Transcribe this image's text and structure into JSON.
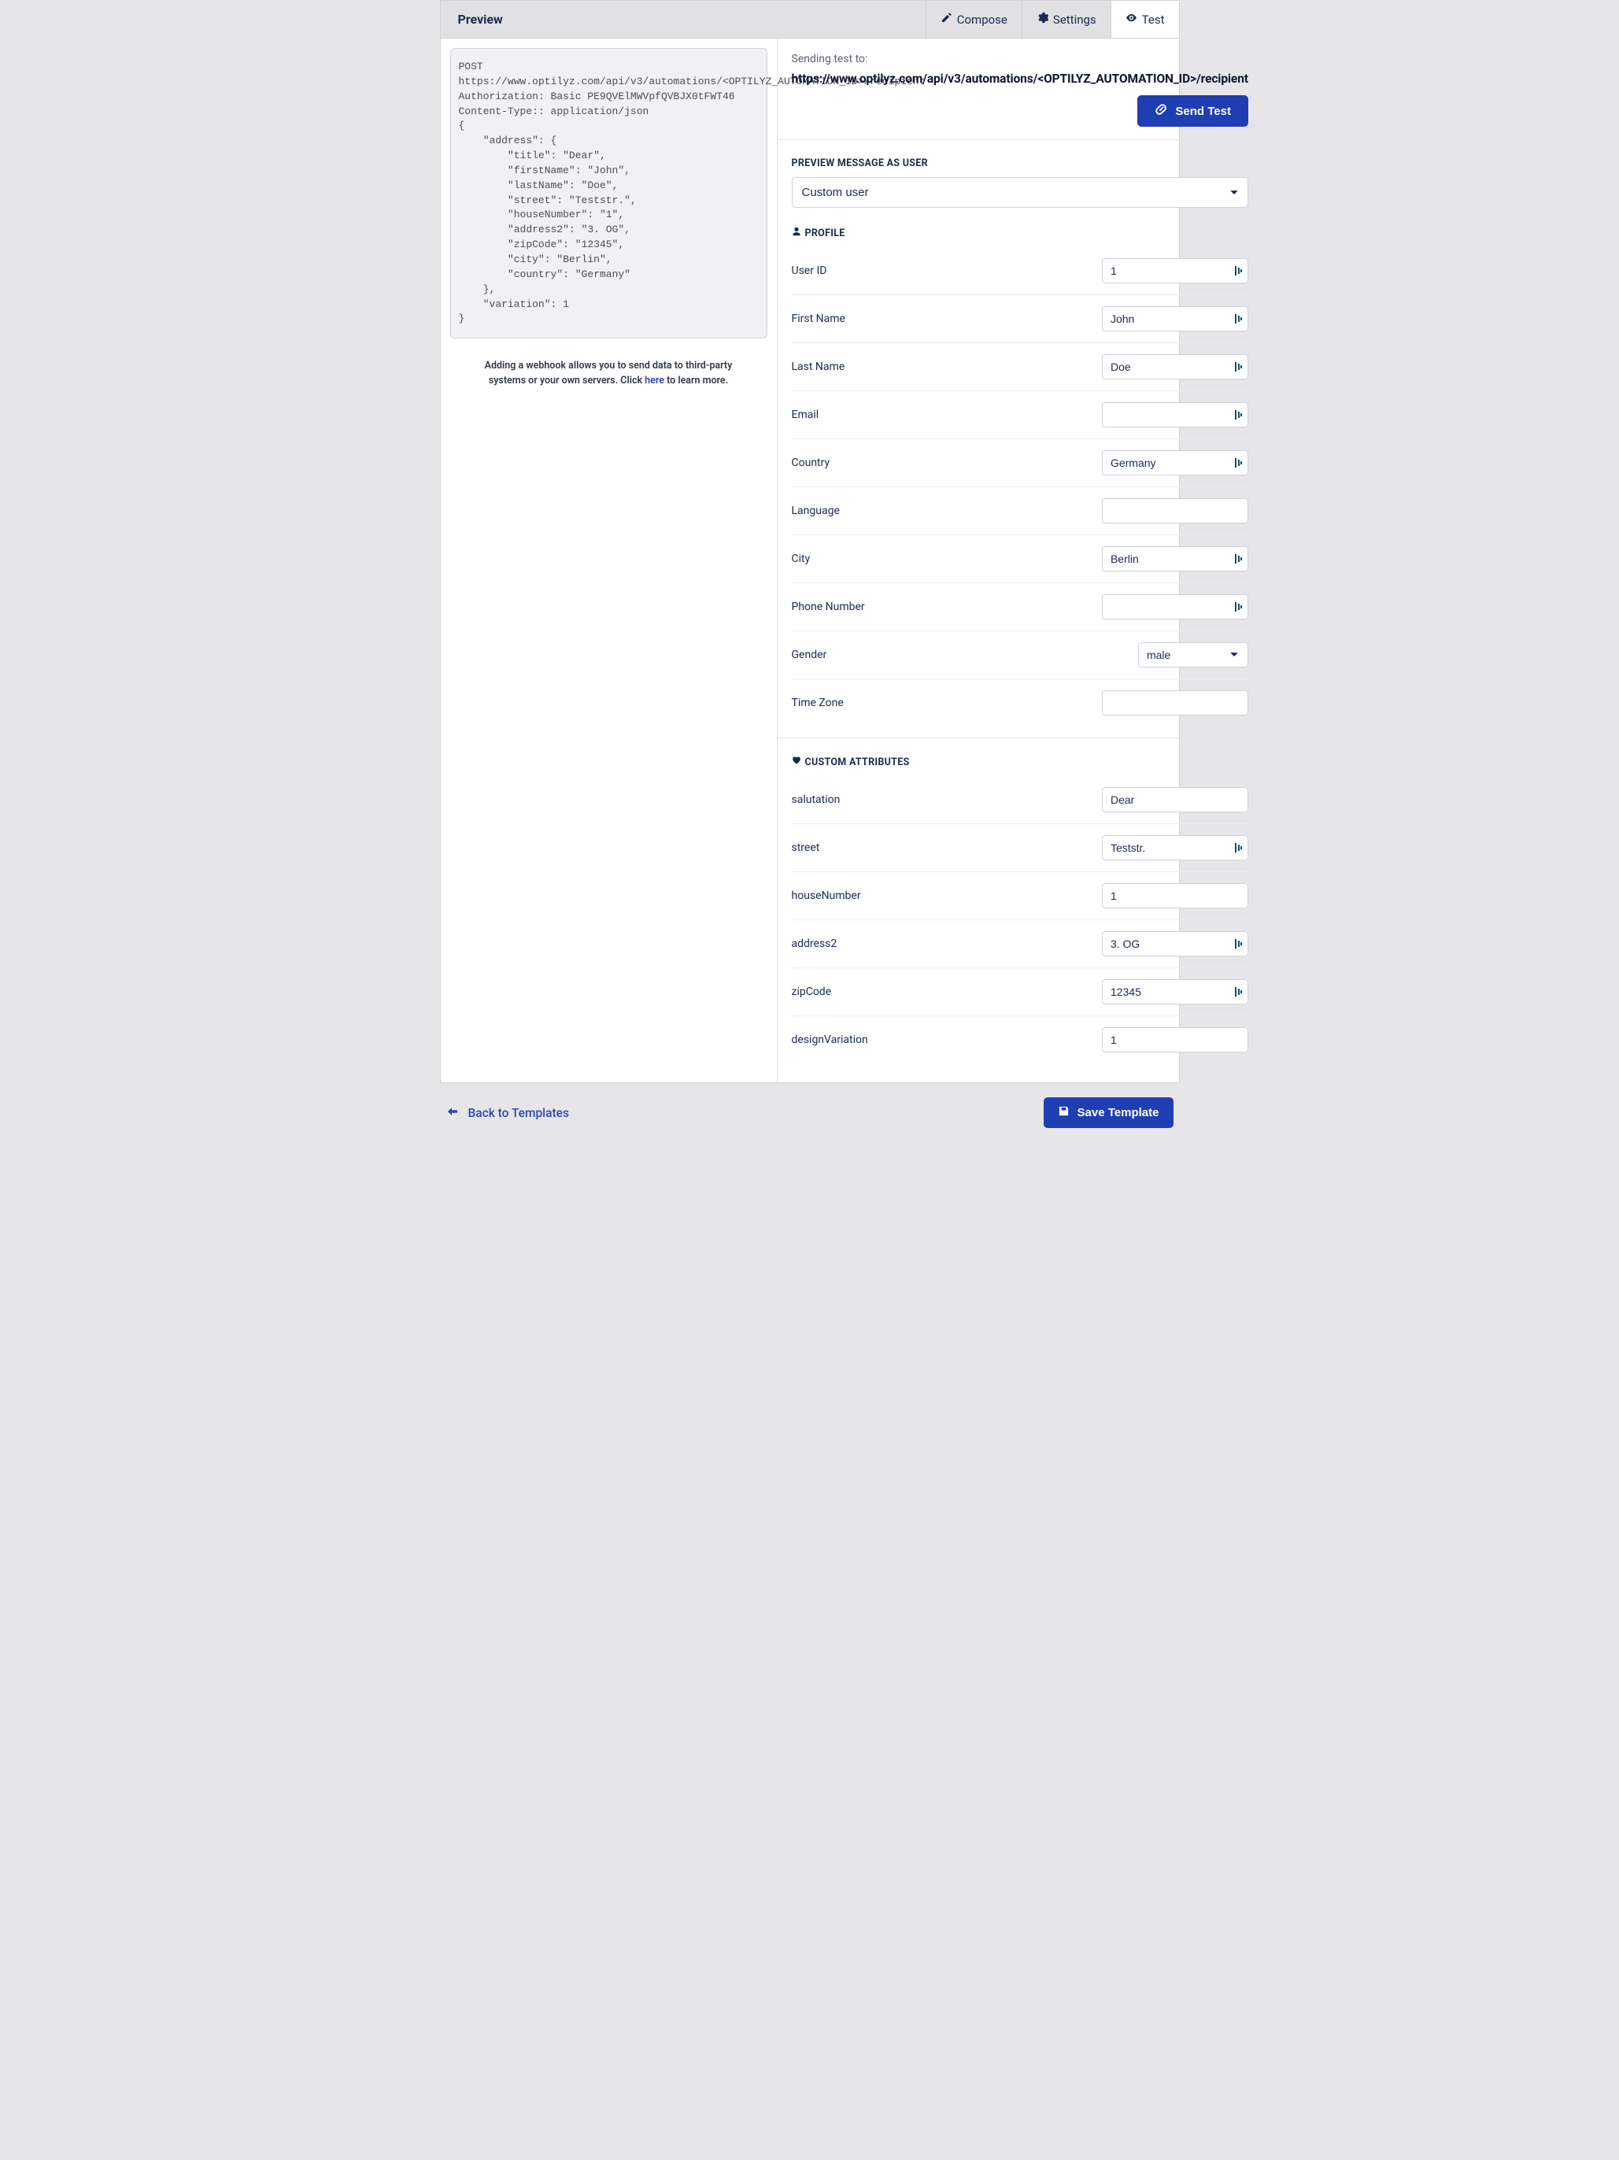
{
  "topbar": {
    "title": "Preview",
    "tabs": {
      "compose": "Compose",
      "settings": "Settings",
      "test": "Test"
    }
  },
  "code": "POST https://www.optilyz.com/api/v3/automations/<OPTILYZ_AUTOMATION_ID>/recipient\nAuthorization: Basic PE9QVElMWVpfQVBJX0tFWT46\nContent-Type:: application/json\n{\n    \"address\": {\n        \"title\": \"Dear\",\n        \"firstName\": \"John\",\n        \"lastName\": \"Doe\",\n        \"street\": \"Teststr.\",\n        \"houseNumber\": \"1\",\n        \"address2\": \"3. OG\",\n        \"zipCode\": \"12345\",\n        \"city\": \"Berlin\",\n        \"country\": \"Germany\"\n    },\n    \"variation\": 1\n}",
  "hint": {
    "prefix": "Adding a webhook allows you to send data to third-party systems or your own servers. Click ",
    "link": "here",
    "suffix": " to learn more."
  },
  "sendTest": {
    "label": "Sending test to:",
    "url": "https://www.optilyz.com/api/v3/automations/<OPTILYZ_AUTOMATION_ID>/recipient",
    "button": "Send Test"
  },
  "previewUser": {
    "title": "PREVIEW MESSAGE AS USER",
    "selected": "Custom user"
  },
  "profile": {
    "title": "PROFILE",
    "fields": {
      "userId": {
        "label": "User ID",
        "value": "1",
        "lock": true
      },
      "firstName": {
        "label": "First Name",
        "value": "John",
        "lock": true
      },
      "lastName": {
        "label": "Last Name",
        "value": "Doe",
        "lock": true
      },
      "email": {
        "label": "Email",
        "value": "",
        "lock": true
      },
      "country": {
        "label": "Country",
        "value": "Germany",
        "lock": true
      },
      "language": {
        "label": "Language",
        "value": "",
        "lock": false
      },
      "city": {
        "label": "City",
        "value": "Berlin",
        "lock": true
      },
      "phone": {
        "label": "Phone Number",
        "value": "",
        "lock": true
      },
      "gender": {
        "label": "Gender",
        "value": "male"
      },
      "timezone": {
        "label": "Time Zone",
        "value": "",
        "lock": false
      }
    }
  },
  "custom": {
    "title": "CUSTOM ATTRIBUTES",
    "fields": {
      "salutation": {
        "label": "salutation",
        "value": "Dear",
        "lock": false
      },
      "street": {
        "label": "street",
        "value": "Teststr.",
        "lock": true
      },
      "houseNumber": {
        "label": "houseNumber",
        "value": "1",
        "lock": false
      },
      "address2": {
        "label": "address2",
        "value": "3. OG",
        "lock": true
      },
      "zipCode": {
        "label": "zipCode",
        "value": "12345",
        "lock": true
      },
      "designVariation": {
        "label": "designVariation",
        "value": "1",
        "lock": false
      }
    }
  },
  "footer": {
    "back": "Back to Templates",
    "save": "Save Template"
  }
}
